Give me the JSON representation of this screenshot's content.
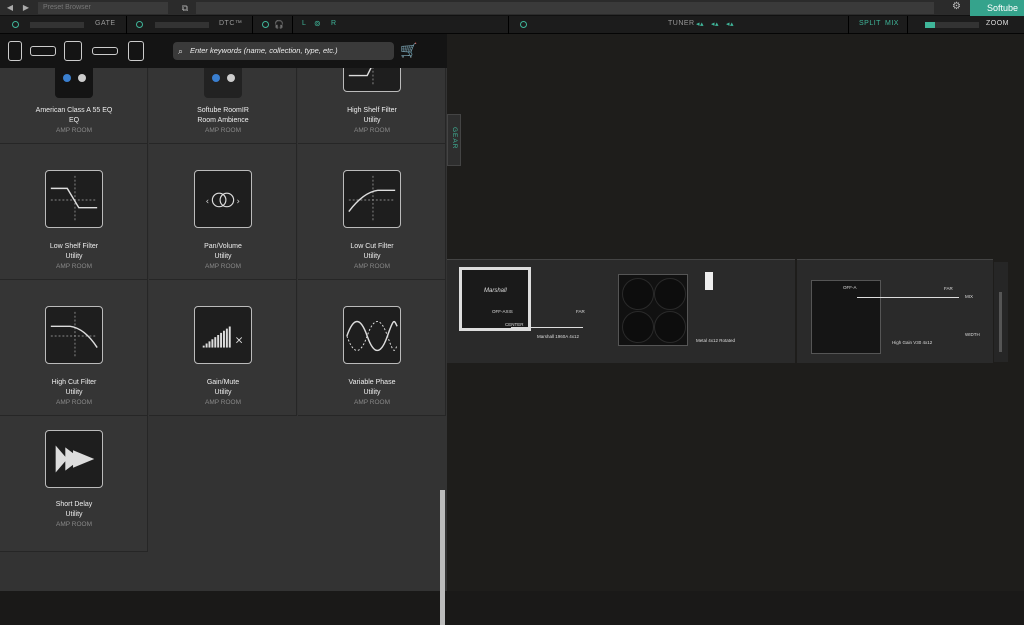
{
  "topbar": {
    "back_icon": "back-arrow-icon",
    "forward_icon": "forward-arrow-icon",
    "preset_placeholder": "Preset Browser",
    "window_icon": "window-icon",
    "settings_icon": "gear-icon",
    "brand": "Softube"
  },
  "signal_bar": {
    "gate_label": "GATE",
    "dtc_label": "DTC™",
    "left_label": "L",
    "right_label": "R",
    "tuner_label": "TUNER",
    "split_label": "SPLIT",
    "mix_label": "MIX",
    "zoom_label": "ZOOM"
  },
  "browser": {
    "search_placeholder": "Enter keywords (name, collection, type, etc.)",
    "items": [
      {
        "name": "American Class A 55 EQ",
        "type": "EQ",
        "collection": "AMP ROOM"
      },
      {
        "name": "Softube RoomIR",
        "type": "Room Ambience",
        "collection": "AMP ROOM"
      },
      {
        "name": "High Shelf Filter",
        "type": "Utility",
        "collection": "AMP ROOM"
      },
      {
        "name": "Low Shelf Filter",
        "type": "Utility",
        "collection": "AMP ROOM"
      },
      {
        "name": "Pan/Volume",
        "type": "Utility",
        "collection": "AMP ROOM"
      },
      {
        "name": "Low Cut Filter",
        "type": "Utility",
        "collection": "AMP ROOM"
      },
      {
        "name": "High Cut Filter",
        "type": "Utility",
        "collection": "AMP ROOM"
      },
      {
        "name": "Gain/Mute",
        "type": "Utility",
        "collection": "AMP ROOM"
      },
      {
        "name": "Variable Phase",
        "type": "Utility",
        "collection": "AMP ROOM"
      },
      {
        "name": "Short Delay",
        "type": "Utility",
        "collection": "AMP ROOM"
      }
    ]
  },
  "stage": {
    "gear_tab": "GEAR",
    "cab1": {
      "brand": "Marshall",
      "mic_off": "OFF-AXIS",
      "mic_far": "FAR",
      "mic_center": "CENTER",
      "model": "Marshall 1960A 4x12"
    },
    "cab2": {
      "model": "Metal 4x12 Rotated"
    },
    "cab3": {
      "mic_off": "OFF-A",
      "mic_far": "FAR",
      "model": "High Gain V30 4x12",
      "mix": "MIX",
      "width": "WIDTH"
    }
  },
  "colors": {
    "accent": "#3fb69a",
    "panel": "#333333",
    "stage": "#1e1d1b"
  }
}
